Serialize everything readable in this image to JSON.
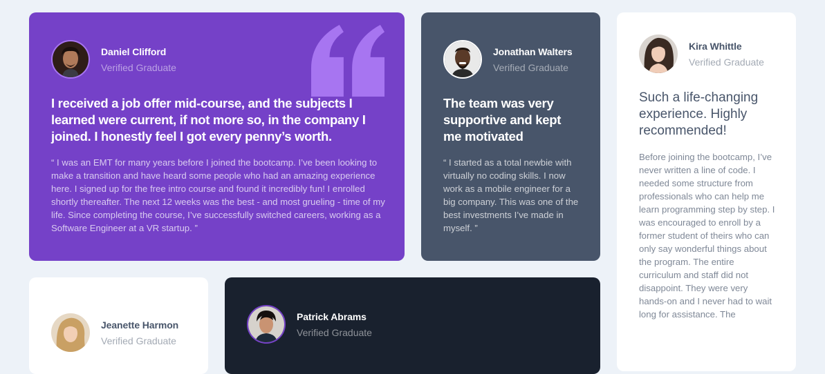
{
  "colors": {
    "page_background": "#edf2f8",
    "moderate_violet": "#7541c8",
    "grayish_blue": "#48556a",
    "very_dark_blackish_blue": "#19212e",
    "white": "#ffffff",
    "quote_accent": "#a775f1"
  },
  "testimonials": [
    {
      "name": "Daniel Clifford",
      "role": "Verified Graduate",
      "headline": "I received a job offer mid-course, and the subjects I learned were current, if not more so, in the company I joined. I honestly feel I got every penny’s worth.",
      "body": "“ I was an EMT for many years before I joined the bootcamp. I’ve been looking to make a transition and have heard some people who had an amazing experience here. I signed up for the free intro course and found it incredibly fun! I enrolled shortly thereafter. The next 12 weeks was the best - and most grueling - time of my life. Since completing the course, I’ve successfully switched careers, working as a Software Engineer at a VR startup. ”",
      "decoration_icon": "quotation-mark-icon"
    },
    {
      "name": "Jonathan Walters",
      "role": "Verified Graduate",
      "headline": "The team was very supportive and kept me motivated",
      "body": "“ I started as a total newbie with virtually no coding skills. I now work as a mobile engineer for a big company. This was one of the best investments I’ve made in myself. ”"
    },
    {
      "name": "Kira Whittle",
      "role": "Verified Graduate",
      "headline": "Such a life-changing experience. Highly recommended!",
      "body": "Before joining the bootcamp, I’ve never written a line of code. I needed some structure from professionals who can help me learn programming step by step. I was encouraged to enroll by a former student of theirs who can only say wonderful things about the program. The entire curriculum and staff did not disappoint. They were very hands-on and I never had to wait long for assistance. The"
    },
    {
      "name": "Jeanette Harmon",
      "role": "Verified Graduate"
    },
    {
      "name": "Patrick Abrams",
      "role": "Verified Graduate"
    }
  ]
}
